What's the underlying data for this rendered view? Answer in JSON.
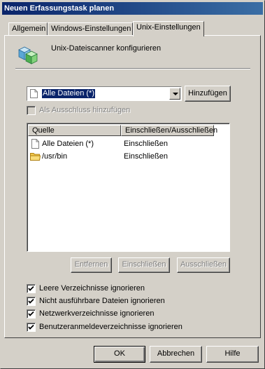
{
  "window": {
    "title": "Neuen Erfassungstask planen"
  },
  "tabs": [
    {
      "label": "Allgemein"
    },
    {
      "label": "Windows-Einstellungen"
    },
    {
      "label": "Unix-Einstellungen"
    }
  ],
  "heading": "Unix-Dateiscanner konfigurieren",
  "selector": {
    "selected": "Alle Dateien (*)",
    "add_button": "Hinzufügen"
  },
  "exclude_option": {
    "label": "Als Ausschluss hinzufügen",
    "checked": false,
    "disabled": true
  },
  "table": {
    "columns": [
      "Quelle",
      "Einschließen/Ausschließen"
    ],
    "rows": [
      {
        "icon": "file-icon",
        "source": "Alle Dateien (*)",
        "mode": "Einschließen"
      },
      {
        "icon": "folder-icon",
        "source": "/usr/bin",
        "mode": "Einschließen"
      }
    ]
  },
  "list_buttons": {
    "remove": "Entfernen",
    "include": "Einschließen",
    "exclude": "Ausschließen"
  },
  "options": [
    {
      "label": "Leere Verzeichnisse ignorieren",
      "checked": true
    },
    {
      "label": "Nicht ausführbare Dateien ignorieren",
      "checked": true
    },
    {
      "label": "Netzwerkverzeichnisse ignorieren",
      "checked": true
    },
    {
      "label": "Benutzeranmeldeverzeichnisse ignorieren",
      "checked": true
    }
  ],
  "footer": {
    "ok": "OK",
    "cancel": "Abbrechen",
    "help": "Hilfe"
  }
}
